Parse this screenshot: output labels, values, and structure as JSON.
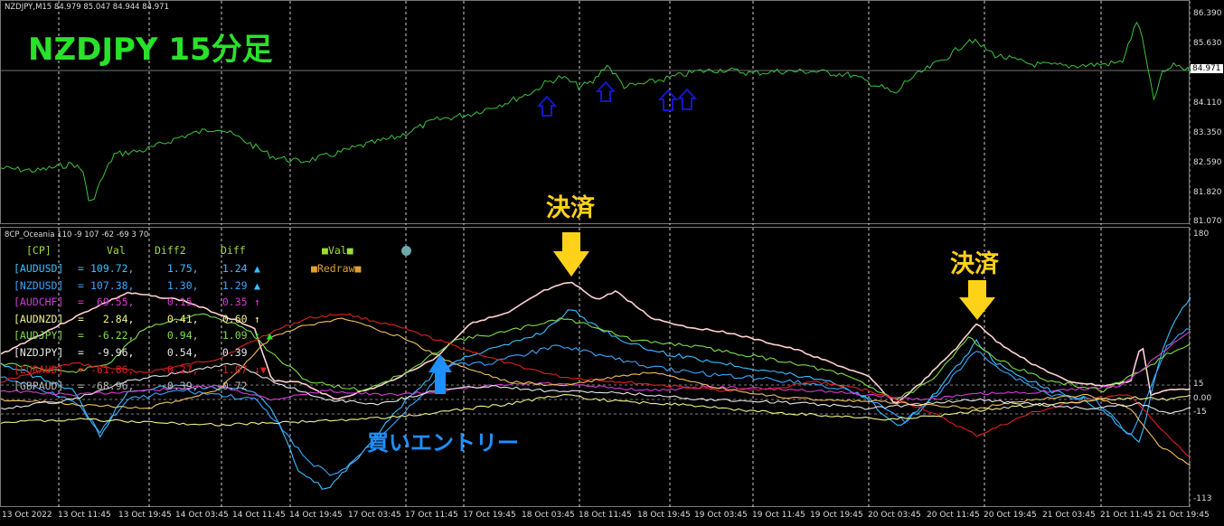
{
  "chart_header": "NZDJPY,M15  84.979 85.047 84.944 84.971",
  "title_overlay": "NZDJPY 15分足",
  "price_axis": [
    "86.390",
    "85.630",
    "84.971",
    "84.110",
    "83.350",
    "82.590",
    "81.820",
    "81.070"
  ],
  "current_price": "84.971",
  "indicator_header": "8CP_Oceania 110 -9 107 -62 -69 3 70",
  "indicator_axis": [
    "180",
    "15",
    "0.00",
    "-15",
    "-113"
  ],
  "table": {
    "head": [
      "[CP]",
      "Val",
      "Diff2",
      "Diff"
    ],
    "rows": [
      {
        "name": "[AUDUSD]",
        "val": "109.72,",
        "diff2": "1.75,",
        "diff": "1.24",
        "mark": "▲",
        "color": "#39c0ff",
        "mark_color": "#39c0ff"
      },
      {
        "name": "[NZDUSD]",
        "val": "107.38,",
        "diff2": "1.30,",
        "diff": "1.29",
        "mark": "▲",
        "color": "#3aa6ff",
        "mark_color": "#39c0ff"
      },
      {
        "name": "[AUDCHF]",
        "val": "69.55,",
        "diff2": "0.15,",
        "diff": "0.35",
        "mark": "↑",
        "color": "#d63bd6",
        "mark_color": "#d63bd6"
      },
      {
        "name": "[AUDNZD]",
        "val": "2.84,",
        "diff2": "0.41,",
        "diff": "0.60",
        "mark": "↑",
        "color": "#f0f08c",
        "mark_color": "#f0f08c"
      },
      {
        "name": "[AUDJPY]",
        "val": "-6.22,",
        "diff2": "0.94,",
        "diff": "1.09",
        "mark": "↑ ▲",
        "color": "#7fdc4a",
        "mark_color": "#22ee22"
      },
      {
        "name": "[NZDJPY]",
        "val": "-9.96,",
        "diff2": "0.54,",
        "diff": "0.39",
        "mark": "",
        "color": "#e8e8e8",
        "mark_color": "#e8e8e8"
      },
      {
        "name": "[EURAUD]",
        "val": "-61.86,",
        "diff2": "-0.27,",
        "diff": "-1.07",
        "mark": "↓▼",
        "color": "#e02020",
        "mark_color": "#e02020"
      },
      {
        "name": "[GBPAUD]",
        "val": "-68.96,",
        "diff2": "-0.39,",
        "diff": "-0.72",
        "mark": "",
        "color": "#bbbbbb",
        "mark_color": "#bbbbbb"
      }
    ]
  },
  "legend": {
    "val_label": "Val",
    "redraw_label": "Redraw"
  },
  "annotations": {
    "settle_1": "決済",
    "settle_2": "決済",
    "entry": "買いエントリー"
  },
  "time_axis": [
    "13 Oct 2022",
    "13 Oct 11:45",
    "13 Oct 19:45",
    "14 Oct 03:45",
    "14 Oct 11:45",
    "14 Oct 19:45",
    "17 Oct 03:45",
    "17 Oct 11:45",
    "17 Oct 19:45",
    "18 Oct 03:45",
    "18 Oct 11:45",
    "18 Oct 19:45",
    "19 Oct 03:45",
    "19 Oct 11:45",
    "19 Oct 19:45",
    "20 Oct 03:45",
    "20 Oct 11:45",
    "20 Oct 19:45",
    "21 Oct 03:45",
    "21 Oct 11:45",
    "21 Oct 19:45"
  ],
  "colors": {
    "price_line": "#3cc23c",
    "title": "#29e22a",
    "annotation": "#ffd21a",
    "entry": "#1e90ff",
    "up_arrow": "#1515c8"
  }
}
